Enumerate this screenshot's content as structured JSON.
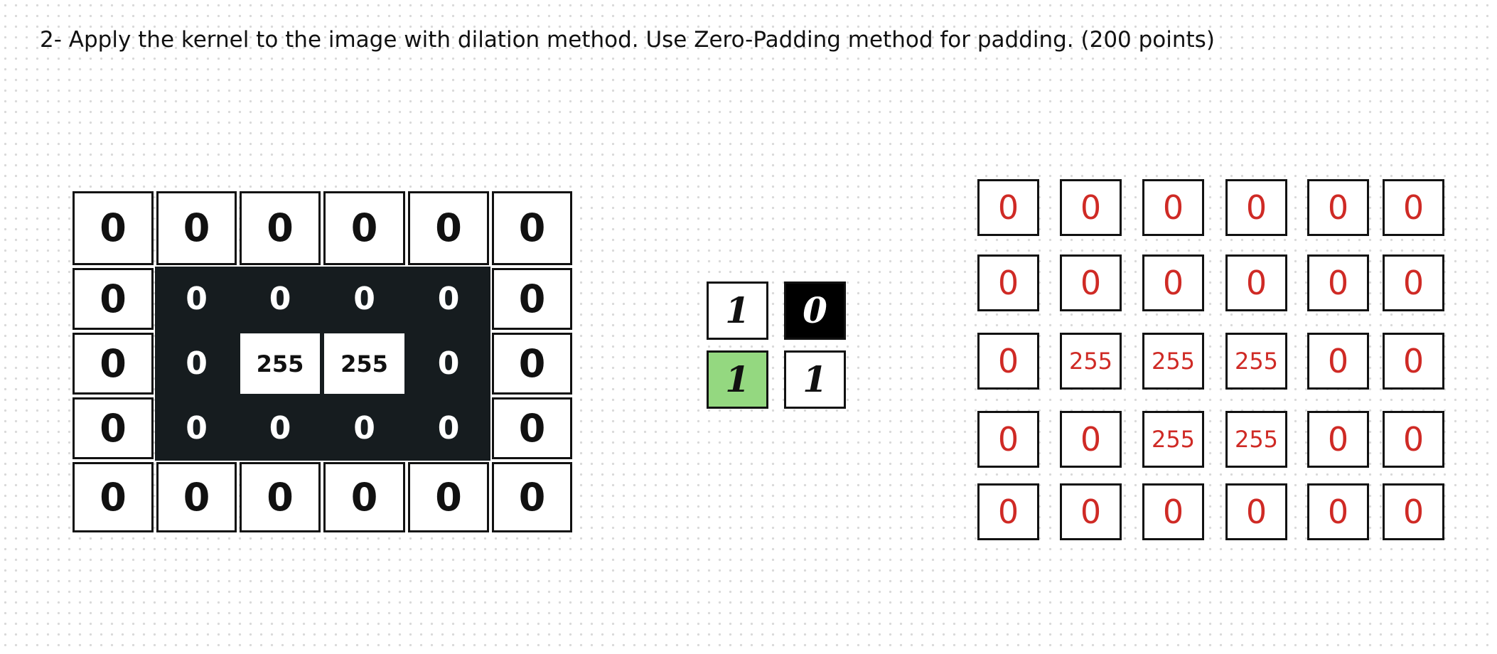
{
  "question": "2- Apply the kernel to the image with dilation method. Use Zero-Padding method for padding. (200 points)",
  "input_image": {
    "rows": [
      [
        "0",
        "0",
        "0",
        "0",
        "0",
        "0"
      ],
      [
        "0",
        "0",
        "0",
        "0",
        "0",
        "0"
      ],
      [
        "0",
        "0",
        "255",
        "255",
        "0",
        "0"
      ],
      [
        "0",
        "0",
        "0",
        "0",
        "0",
        "0"
      ],
      [
        "0",
        "0",
        "0",
        "0",
        "0",
        "0"
      ]
    ]
  },
  "kernel": {
    "rows": [
      [
        "1",
        "0"
      ],
      [
        "1",
        "1"
      ]
    ],
    "origin": "bottom-left",
    "colors": {
      "origin_fill": "#94d880",
      "dark_fill": "#000000"
    }
  },
  "output_image": {
    "rows": [
      [
        "0",
        "0",
        "0",
        "0",
        "0",
        "0"
      ],
      [
        "0",
        "0",
        "0",
        "0",
        "0",
        "0"
      ],
      [
        "0",
        "255",
        "255",
        "255",
        "0",
        "0"
      ],
      [
        "0",
        "0",
        "255",
        "255",
        "0",
        "0"
      ],
      [
        "0",
        "0",
        "0",
        "0",
        "0",
        "0"
      ]
    ],
    "text_color": "#cf2a25"
  },
  "colors": {
    "image_dark": "#161c1f",
    "dot_grid": "#d9d9d9"
  }
}
